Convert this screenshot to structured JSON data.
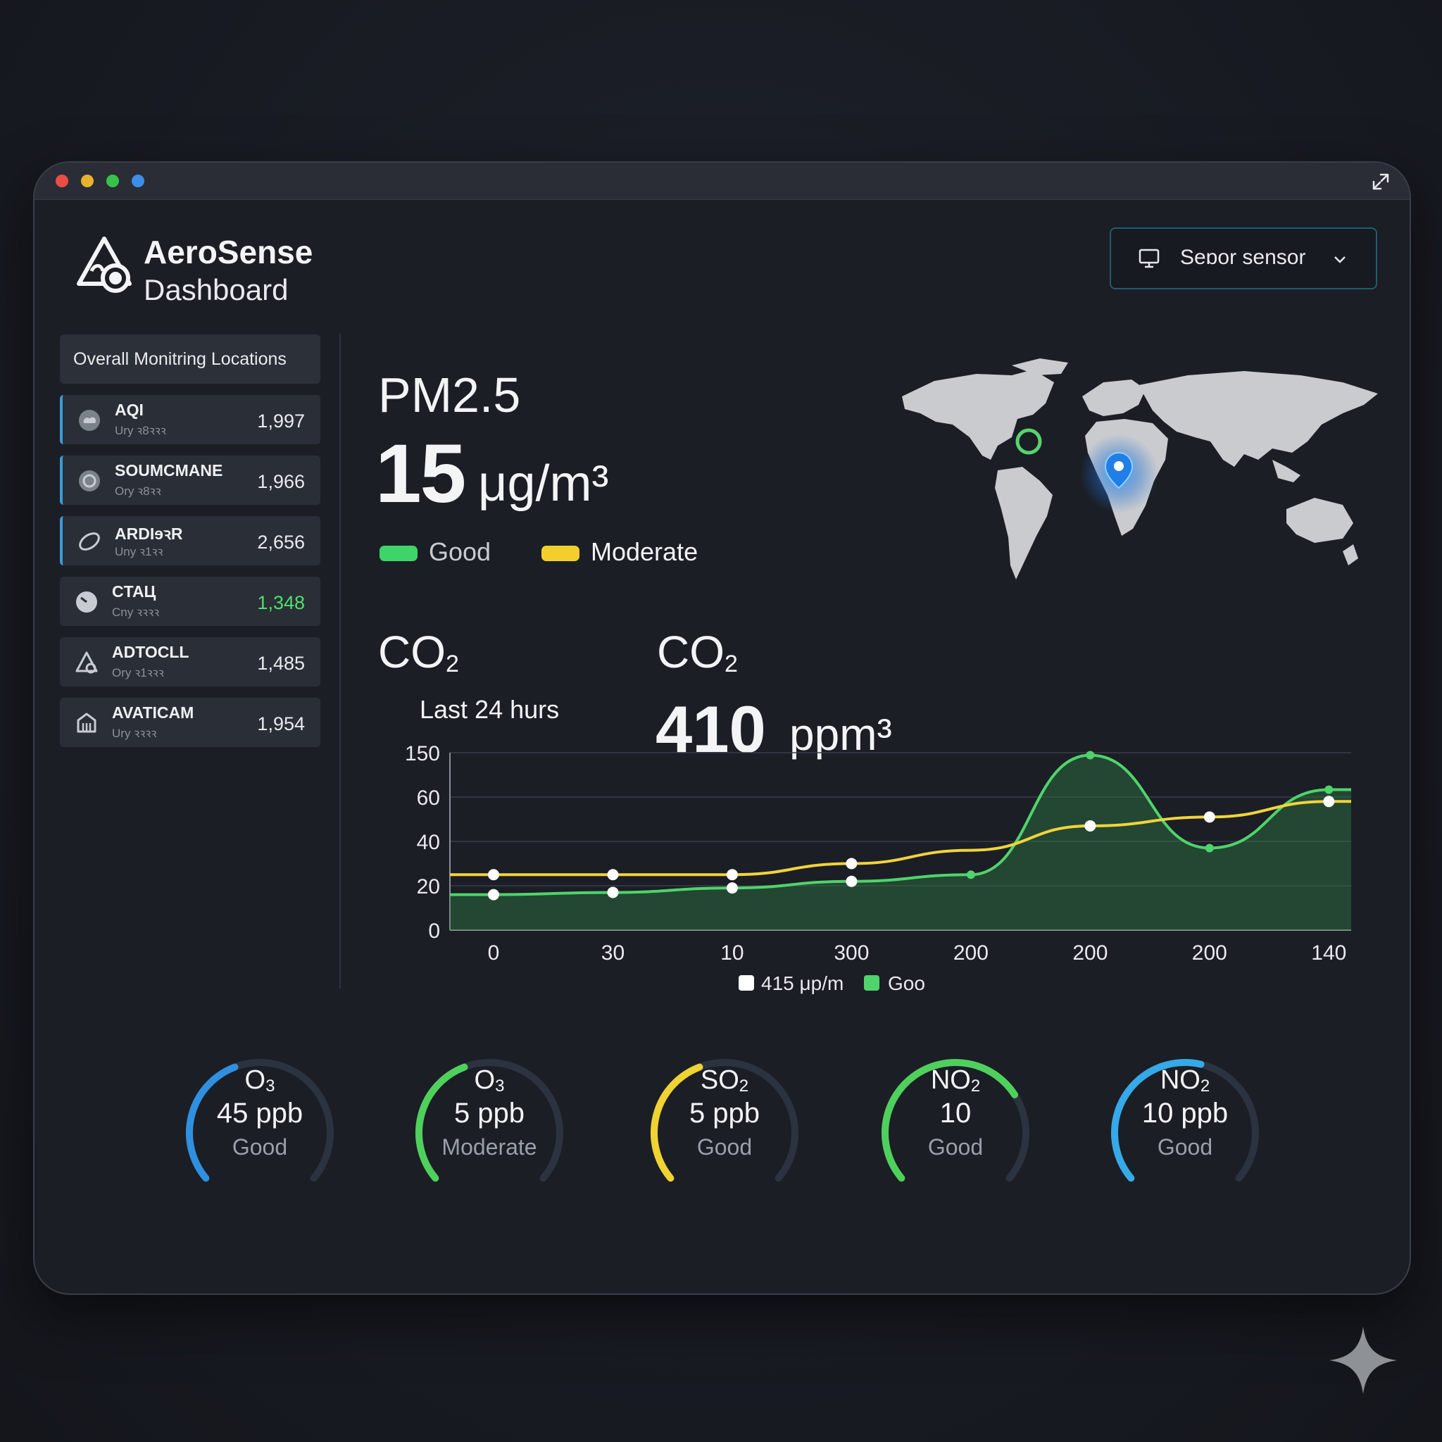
{
  "brand": {
    "name": "AeroSense",
    "subtitle": "Dashboard"
  },
  "sensor_select": {
    "label": "Seɒor sensor"
  },
  "sidebar": {
    "header": "Overall Monitring Locations",
    "items": [
      {
        "name": "AQI",
        "sub": "Ury ꝛ8ꝛꝛꝛ",
        "value": "1,997",
        "icon": "cloud-icon",
        "accent": true
      },
      {
        "name": "SOUMCMANE",
        "sub": "Ory ꝛ8ꝛꝛ",
        "value": "1,966",
        "icon": "globe-icon",
        "accent": true
      },
      {
        "name": "ARDIɘꝛR",
        "sub": "Uny ꝛ1ꝛꝛ",
        "value": "2,656",
        "icon": "leaf-icon",
        "accent": true
      },
      {
        "name": "CTAЦ",
        "sub": "Cny ꝛꝛꝛꝛ",
        "value": "1,348",
        "icon": "gauge-icon",
        "accent": false,
        "highlight": true
      },
      {
        "name": "ADTOCLL",
        "sub": "Ory ꝛ1ꝛꝛꝛ",
        "value": "1,485",
        "icon": "recycle-icon",
        "accent": false
      },
      {
        "name": "AVATICAM",
        "sub": "Ury ꝛꝛꝛꝛ",
        "value": "1,954",
        "icon": "building-icon",
        "accent": false
      }
    ]
  },
  "pm25": {
    "title": "PM2.5",
    "value": "15",
    "unit": "μg/m³",
    "legend": [
      {
        "label": "Good",
        "color": "#3fd46a"
      },
      {
        "label": "Moderate",
        "color": "#f3cf2e"
      }
    ]
  },
  "co2_chart": {
    "label": "CO",
    "label_sub": "2",
    "subtitle": "Last 24 hurs"
  },
  "co2_reading": {
    "label": "CO",
    "label_sub": "2",
    "value": "410",
    "unit": "ppm³"
  },
  "chart_data": {
    "type": "line",
    "categories": [
      "0",
      "30",
      "10",
      "300",
      "200",
      "200",
      "200",
      "140"
    ],
    "y_ticks": [
      "150",
      "60",
      "40",
      "20",
      "0"
    ],
    "series": [
      {
        "name": "415 μp/m",
        "color": "#f0d43a",
        "values": [
          25,
          25,
          25,
          30,
          36,
          47,
          51,
          58
        ]
      },
      {
        "name": "Goo",
        "color": "#4fd36b",
        "values": [
          16,
          17,
          19,
          22,
          25,
          145,
          37,
          75
        ]
      }
    ],
    "legend": [
      {
        "label": "415 μp/m",
        "color": "#ffffff"
      },
      {
        "label": "Goo",
        "color": "#4fd36b"
      }
    ]
  },
  "gauges": [
    {
      "name": "O",
      "name_sub": "3",
      "value": "45 ppb",
      "status": "Good",
      "color": "#2f8fe0",
      "fill": 0.42
    },
    {
      "name": "O",
      "name_sub": "3",
      "value": "5 ppb",
      "status": "Moderate",
      "color": "#4fd05c",
      "fill": 0.42
    },
    {
      "name": "SO",
      "name_sub": "2",
      "value": "5 ppb",
      "status": "Good",
      "color": "#f0d232",
      "fill": 0.42
    },
    {
      "name": "NO",
      "name_sub": "2",
      "value": "10",
      "status": "Good",
      "color": "#4fd05c",
      "fill": 0.72
    },
    {
      "name": "NO",
      "name_sub": "2",
      "value": "10 ppb",
      "status": "Good",
      "color": "#36a9e8",
      "fill": 0.55
    }
  ],
  "map": {
    "markers": [
      "location-pin-blue",
      "location-ring-green"
    ]
  }
}
